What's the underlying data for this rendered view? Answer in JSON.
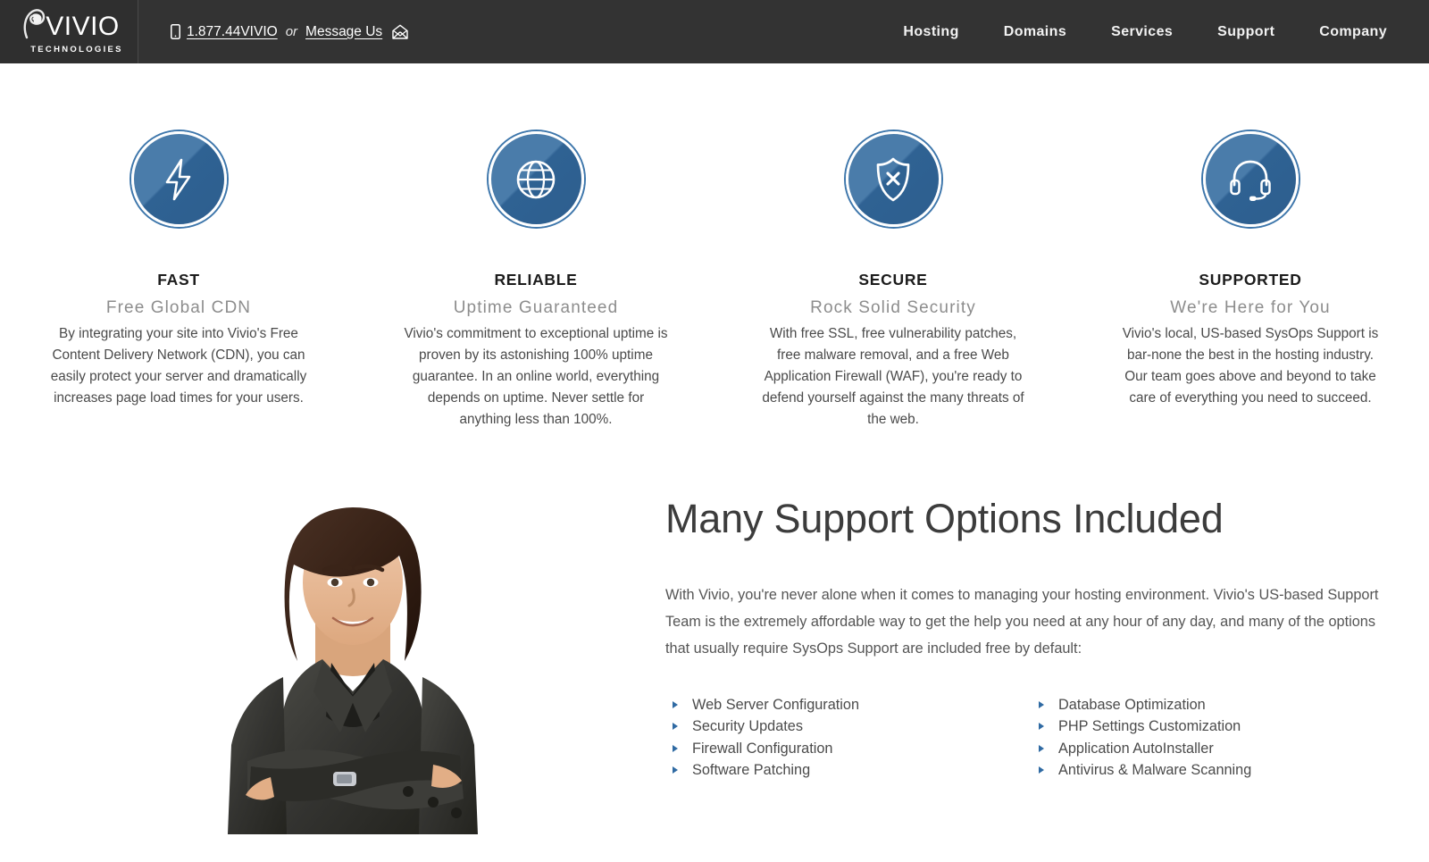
{
  "header": {
    "logo": {
      "word": "VIVIO",
      "sub": "TECHNOLOGIES",
      "mark_icon": "vivio-swirl-icon"
    },
    "contact": {
      "phone_icon": "mobile-phone-icon",
      "phone": "1.877.44VIVIO",
      "separator": "or",
      "message_label": "Message Us",
      "mail_icon": "open-envelope-icon"
    },
    "nav": [
      {
        "label": "Hosting"
      },
      {
        "label": "Domains"
      },
      {
        "label": "Services"
      },
      {
        "label": "Support"
      },
      {
        "label": "Company"
      }
    ]
  },
  "features": [
    {
      "icon": "lightning-bolt-icon",
      "title": "FAST",
      "subtitle": "Free Global CDN",
      "body": "By integrating your site into Vivio's Free Content Delivery Network (CDN), you can easily protect your server and dramatically increases page load times for your users."
    },
    {
      "icon": "globe-icon",
      "title": "RELIABLE",
      "subtitle": "Uptime Guaranteed",
      "body": "Vivio's commitment to exceptional uptime is proven by its astonishing 100% uptime guarantee. In an online world, everything depends on uptime. Never settle for anything less than 100%."
    },
    {
      "icon": "shield-x-icon",
      "title": "SECURE",
      "subtitle": "Rock Solid Security",
      "body": "With free SSL, free vulnerability patches, free malware removal, and a free Web Application Firewall (WAF), you're ready to defend yourself against the many threats of the web."
    },
    {
      "icon": "headset-icon",
      "title": "SUPPORTED",
      "subtitle": "We're Here for You",
      "body": "Vivio's local, US-based SysOps Support is bar-none the best in the hosting industry. Our team goes above and beyond to take care of everything you need to succeed."
    }
  ],
  "support": {
    "photo_alt": "support-representative-photo",
    "heading": "Many Support Options Included",
    "paragraph": "With Vivio, you're never alone when it comes to managing your hosting environment. Vivio's US-based Support Team is the extremely affordable way to get the help you need at any hour of any day, and many of the options that usually require SysOps Support are included free by default:",
    "list_left": [
      "Web Server Configuration",
      "Security Updates",
      "Firewall Configuration",
      "Software Patching"
    ],
    "list_right": [
      "Database Optimization",
      "PHP Settings Customization",
      "Application AutoInstaller",
      "Antivirus & Malware Scanning"
    ]
  },
  "colors": {
    "header_bg": "#333333",
    "logo_bg": "#2f2f2f",
    "icon_blue_light": "#4a7caa",
    "icon_blue_dark": "#2d5e8e",
    "bullet_blue": "#2f6aa3",
    "subtitle_gray": "#8d8d8d",
    "body_gray": "#4a4a4a"
  }
}
